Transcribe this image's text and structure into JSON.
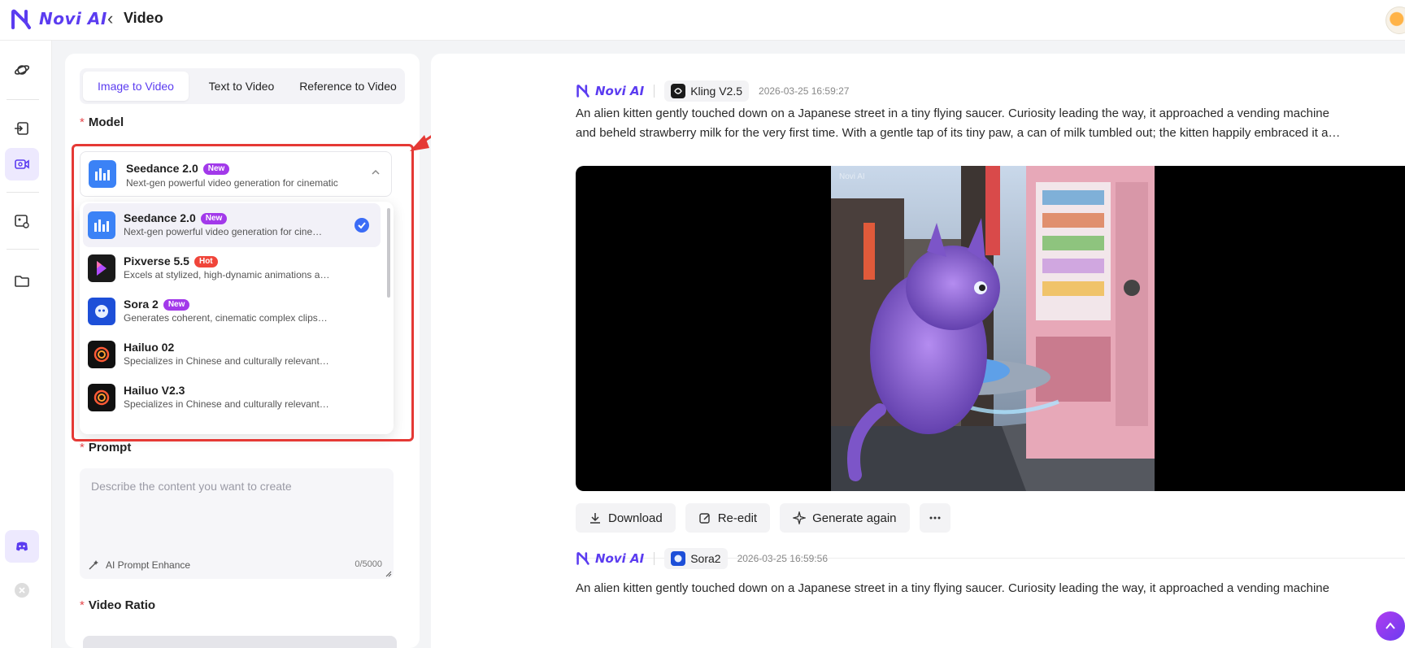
{
  "header": {
    "brand": "Novi AI",
    "back_icon": "chevron-left-icon",
    "title": "Video"
  },
  "rail": {
    "icons": [
      "planet-icon",
      "image-import-icon",
      "video-camera-icon",
      "image-edit-icon",
      "folder-icon",
      "discord-icon",
      "close-icon"
    ]
  },
  "form": {
    "tabs": [
      {
        "label": "Image to Video",
        "active": true
      },
      {
        "label": "Text to Video",
        "active": false
      },
      {
        "label": "Reference to Video",
        "active": false
      }
    ],
    "model_label": "Model",
    "required_mark": "*",
    "selected_model": {
      "name": "Seedance 2.0",
      "badge": "New",
      "description": "Next-gen powerful video generation for cinematic"
    },
    "model_options": [
      {
        "name": "Seedance 2.0",
        "badge": "New",
        "badge_type": "new",
        "description": "Next-gen powerful video generation for cinematic-",
        "selected": true
      },
      {
        "name": "Pixverse 5.5",
        "badge": "Hot",
        "badge_type": "hot",
        "description": "Excels at stylized, high-dynamic animations and s",
        "selected": false
      },
      {
        "name": "Sora 2",
        "badge": "New",
        "badge_type": "new",
        "description": "Generates coherent, cinematic complex clips with",
        "selected": false
      },
      {
        "name": "Hailuo 02",
        "badge": "",
        "badge_type": "",
        "description": "Specializes in Chinese and culturally relevant cont",
        "selected": false
      },
      {
        "name": "Hailuo V2.3",
        "badge": "",
        "badge_type": "",
        "description": "Specializes in Chinese and culturally relevant cont",
        "selected": false
      }
    ],
    "prompt_label": "Prompt",
    "prompt_placeholder": "Describe the content you want to create",
    "enhance_label": "AI Prompt Enhance",
    "char_count": "0/5000",
    "ratio_label": "Video Ratio"
  },
  "results": [
    {
      "brand": "Novi AI",
      "model": "Kling V2.5",
      "time": "2026-03-25 16:59:27",
      "line1": "An alien kitten gently touched down on a Japanese street in a tiny flying saucer. Curiosity leading the way, it approached a vending machine",
      "line2": "and beheld strawberry milk for the very first time. With a gentle tap of its tiny paw, a can of milk tumbled out; the kitten happily embraced it a…",
      "watermark": "Novi AI"
    },
    {
      "brand": "Novi AI",
      "model": "Sora2",
      "time": "2026-03-25 16:59:56",
      "line1": "An alien kitten gently touched down on a Japanese street in a tiny flying saucer. Curiosity leading the way, it approached a vending machine"
    }
  ],
  "actions": {
    "download": "Download",
    "reedit": "Re-edit",
    "generate_again": "Generate again",
    "more": "more-dots-icon"
  },
  "colors": {
    "brand": "#5b3cf0",
    "highlight": "#e53935",
    "badge_new": "#a239ea",
    "badge_hot": "#f0453a",
    "check": "#3b6cf6"
  }
}
